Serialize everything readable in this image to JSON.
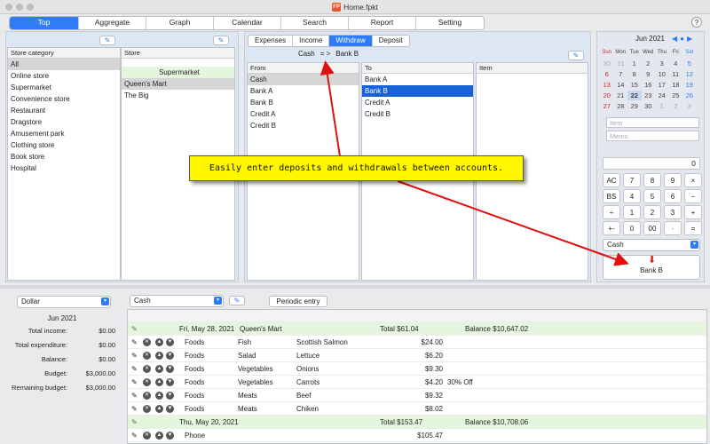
{
  "window": {
    "title": "Home.fpkt",
    "app_icon": "FP"
  },
  "tabs": [
    {
      "label": "Top",
      "active": true
    },
    {
      "label": "Aggregate"
    },
    {
      "label": "Graph"
    },
    {
      "label": "Calendar"
    },
    {
      "label": "Search"
    },
    {
      "label": "Report"
    },
    {
      "label": "Setting"
    }
  ],
  "help_label": "?",
  "store_category": {
    "header": "Store category",
    "items": [
      "All",
      "Online store",
      "Supermarket",
      "Convenience store",
      "Restaurant",
      "Dragstore",
      "Amusement park",
      "Clothing store",
      "Book store",
      "Hospital"
    ]
  },
  "store": {
    "header": "Store",
    "group": "Supermarket",
    "items": [
      "Queen's Mart",
      "The Big"
    ]
  },
  "modes": [
    "Expenses",
    "Income",
    "Withdraw",
    "Deposit"
  ],
  "transfer": {
    "from": "Cash",
    "arrow": "= >",
    "to": "Bank B"
  },
  "from_list": {
    "header": "From",
    "items": [
      "Cash",
      "Bank A",
      "Bank B",
      "Credit A",
      "Credit B"
    ]
  },
  "to_list": {
    "header": "To",
    "items": [
      "Bank A",
      "Bank B",
      "Credit A",
      "Credit B"
    ]
  },
  "item_list": {
    "header": "Item"
  },
  "calendar": {
    "month": "Jun 2021",
    "weekdays": [
      "Sun",
      "Mon",
      "Tue",
      "Wed",
      "Thu",
      "Fri",
      "Sat"
    ],
    "days": [
      "30",
      "31",
      "1",
      "2",
      "3",
      "4",
      "5",
      "6",
      "7",
      "8",
      "9",
      "10",
      "11",
      "12",
      "13",
      "14",
      "15",
      "16",
      "17",
      "18",
      "19",
      "20",
      "21",
      "22",
      "23",
      "24",
      "25",
      "26",
      "27",
      "28",
      "29",
      "30",
      "1",
      "2",
      "3"
    ],
    "selected": "22"
  },
  "entry": {
    "item_placeholder": "Item",
    "memo_placeholder": "Memo",
    "amount": "0"
  },
  "keypad": [
    [
      "AC",
      "7",
      "8",
      "9",
      "×"
    ],
    [
      "BS",
      "4",
      "5",
      "6",
      "−"
    ],
    [
      "÷",
      "1",
      "2",
      "3",
      "+"
    ],
    [
      "+-",
      "0",
      "00",
      "·",
      "="
    ]
  ],
  "account_select": "Cash",
  "commit_button": "Bank B",
  "balloon_text": "Easily enter deposits and withdrawals between accounts.",
  "summary": {
    "currency": "Dollar",
    "month": "Jun 2021",
    "rows": [
      {
        "label": "Total income:",
        "value": "$0.00"
      },
      {
        "label": "Total expenditure:",
        "value": "$0.00"
      },
      {
        "label": "Balance:",
        "value": "$0.00"
      },
      {
        "label": "Budget:",
        "value": "$3,000.00"
      },
      {
        "label": "Remaining budget:",
        "value": "$3,000.00"
      }
    ]
  },
  "account_filter": "Cash",
  "periodic_button": "Periodic entry",
  "transactions": [
    {
      "type": "day",
      "date": "Fri, May 28, 2021",
      "store": "Queen's Mart",
      "total": "Total $61.04",
      "balance": "Balance $10,647.02"
    },
    {
      "type": "item",
      "cat": "Foods",
      "sub": "Fish",
      "item": "Scottish Salmon",
      "amount": "$24.00",
      "note": ""
    },
    {
      "type": "item",
      "cat": "Foods",
      "sub": "Salad",
      "item": "Lettuce",
      "amount": "$6.20",
      "note": ""
    },
    {
      "type": "item",
      "cat": "Foods",
      "sub": "Vegetables",
      "item": "Onions",
      "amount": "$9.30",
      "note": ""
    },
    {
      "type": "item",
      "cat": "Foods",
      "sub": "Vegetables",
      "item": "Carrots",
      "amount": "$4.20",
      "note": "30% Off"
    },
    {
      "type": "item",
      "cat": "Foods",
      "sub": "Meats",
      "item": "Beef",
      "amount": "$9.32",
      "note": ""
    },
    {
      "type": "item",
      "cat": "Foods",
      "sub": "Meats",
      "item": "Chiken",
      "amount": "$8.02",
      "note": ""
    },
    {
      "type": "day",
      "date": "Thu, May 20, 2021",
      "store": "",
      "total": "Total $153.47",
      "balance": "Balance $10,708.06"
    },
    {
      "type": "item",
      "cat": "Phone",
      "sub": "",
      "item": "",
      "amount": "$105.47",
      "note": ""
    }
  ]
}
